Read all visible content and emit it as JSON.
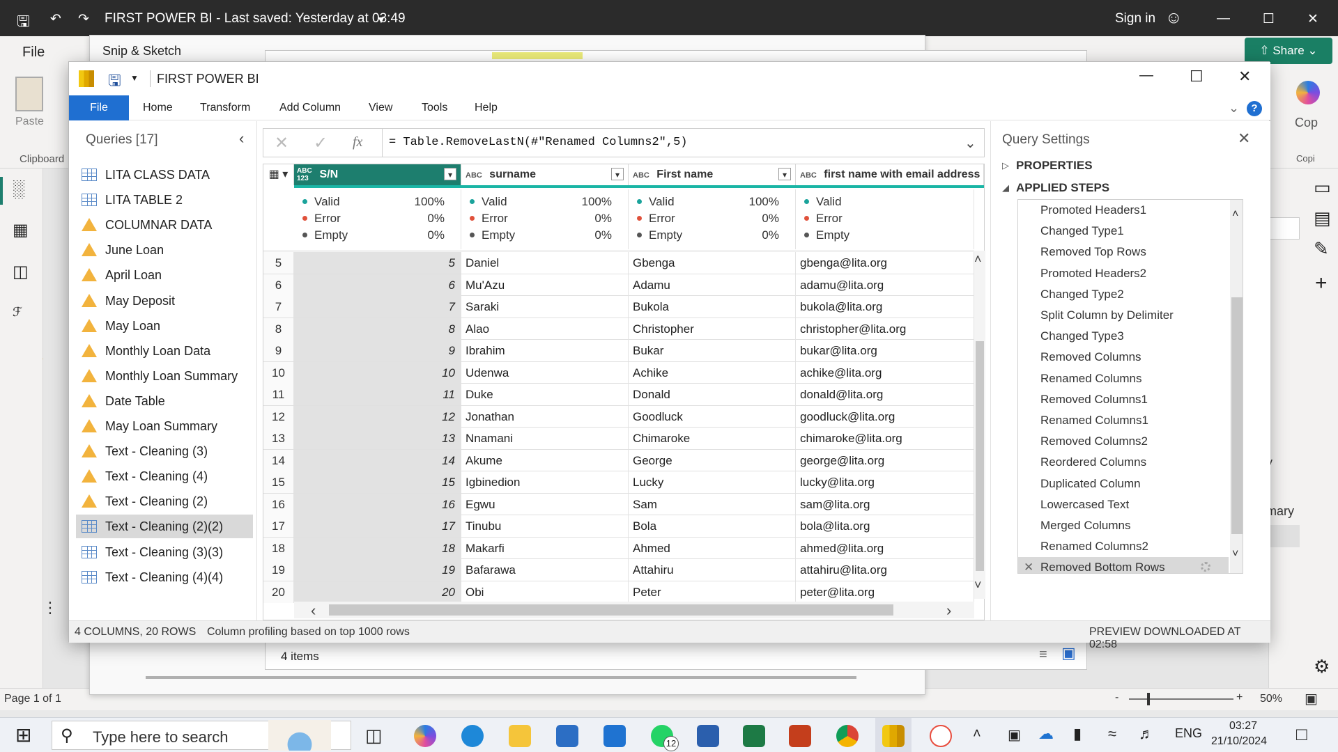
{
  "pbi": {
    "title": "FIRST POWER BI - Last saved: Yesterday at 03:49",
    "sign_in": "Sign in",
    "file_tab": "File",
    "share": "Share",
    "paste": "Paste",
    "clipboard": "Clipboard",
    "copilot": "Cop",
    "copilot2": "Copi",
    "page": "Page 1 of 1",
    "zoom": "50%",
    "side_text1": "y",
    "side_text2": "mary"
  },
  "snip": {
    "title": "Snip & Sketch"
  },
  "explorer": {
    "items": "4 items"
  },
  "pq": {
    "title": "FIRST POWER BI",
    "menu": [
      "File",
      "Home",
      "Transform",
      "Add Column",
      "View",
      "Tools",
      "Help"
    ],
    "queries_header": "Queries [17]",
    "queries": [
      {
        "name": "LITA CLASS DATA",
        "icon": "table-icon"
      },
      {
        "name": "LITA TABLE 2",
        "icon": "table-icon"
      },
      {
        "name": "COLUMNAR DATA",
        "icon": "warning-icon"
      },
      {
        "name": "June Loan",
        "icon": "warning-icon"
      },
      {
        "name": "April Loan",
        "icon": "warning-icon"
      },
      {
        "name": "May Deposit",
        "icon": "warning-icon"
      },
      {
        "name": "May Loan",
        "icon": "warning-icon"
      },
      {
        "name": "Monthly Loan Data",
        "icon": "warning-icon"
      },
      {
        "name": "Monthly Loan Summary",
        "icon": "warning-icon"
      },
      {
        "name": "Date Table",
        "icon": "warning-icon"
      },
      {
        "name": "May Loan Summary",
        "icon": "warning-icon"
      },
      {
        "name": "Text - Cleaning (3)",
        "icon": "warning-icon"
      },
      {
        "name": "Text - Cleaning (4)",
        "icon": "warning-icon"
      },
      {
        "name": "Text - Cleaning (2)",
        "icon": "warning-icon"
      },
      {
        "name": "Text - Cleaning (2)(2)",
        "icon": "table-icon"
      },
      {
        "name": "Text - Cleaning (3)(3)",
        "icon": "table-icon"
      },
      {
        "name": "Text - Cleaning (4)(4)",
        "icon": "table-icon"
      }
    ],
    "formula": "= Table.RemoveLastN(#\"Renamed Columns2\",5)",
    "fx": "fx",
    "columns": [
      {
        "type": "ABC 123",
        "name": "S/N"
      },
      {
        "type": "ABC",
        "name": "surname"
      },
      {
        "type": "ABC",
        "name": "First name"
      },
      {
        "type": "ABC",
        "name": "first name with email address"
      }
    ],
    "quality": {
      "valid_label": "Valid",
      "error_label": "Error",
      "empty_label": "Empty",
      "cols": [
        {
          "valid": "100%",
          "error": "0%",
          "empty": "0%"
        },
        {
          "valid": "100%",
          "error": "0%",
          "empty": "0%"
        },
        {
          "valid": "100%",
          "error": "0%",
          "empty": "0%"
        },
        {
          "valid": "",
          "error": "",
          "empty": ""
        }
      ]
    },
    "rows": [
      [
        "5",
        "5",
        "Daniel",
        "Gbenga",
        "gbenga@lita.org"
      ],
      [
        "6",
        "6",
        "Mu'Azu",
        "Adamu",
        "adamu@lita.org"
      ],
      [
        "7",
        "7",
        "Saraki",
        "Bukola",
        "bukola@lita.org"
      ],
      [
        "8",
        "8",
        "Alao",
        "Christopher",
        "christopher@lita.org"
      ],
      [
        "9",
        "9",
        "Ibrahim",
        "Bukar",
        "bukar@lita.org"
      ],
      [
        "10",
        "10",
        "Udenwa",
        "Achike",
        "achike@lita.org"
      ],
      [
        "11",
        "11",
        "Duke",
        "Donald",
        "donald@lita.org"
      ],
      [
        "12",
        "12",
        "Jonathan",
        "Goodluck",
        "goodluck@lita.org"
      ],
      [
        "13",
        "13",
        "Nnamani",
        "Chimaroke",
        "chimaroke@lita.org"
      ],
      [
        "14",
        "14",
        "Akume",
        "George",
        "george@lita.org"
      ],
      [
        "15",
        "15",
        "Igbinedion",
        "Lucky",
        "lucky@lita.org"
      ],
      [
        "16",
        "16",
        "Egwu",
        "Sam",
        "sam@lita.org"
      ],
      [
        "17",
        "17",
        "Tinubu",
        "Bola",
        "bola@lita.org"
      ],
      [
        "18",
        "18",
        "Makarfi",
        "Ahmed",
        "ahmed@lita.org"
      ],
      [
        "19",
        "19",
        "Bafarawa",
        "Attahiru",
        "attahiru@lita.org"
      ],
      [
        "20",
        "20",
        "Obi",
        "Peter",
        "peter@lita.org"
      ]
    ],
    "settings_title": "Query Settings",
    "properties": "PROPERTIES",
    "applied_steps": "APPLIED STEPS",
    "steps": [
      {
        "name": "Promoted Headers1",
        "gear": true
      },
      {
        "name": "Changed Type1",
        "gear": false
      },
      {
        "name": "Removed Top Rows",
        "gear": true
      },
      {
        "name": "Promoted Headers2",
        "gear": true
      },
      {
        "name": "Changed Type2",
        "gear": false
      },
      {
        "name": "Split Column by Delimiter",
        "gear": true
      },
      {
        "name": "Changed Type3",
        "gear": false
      },
      {
        "name": "Removed Columns",
        "gear": false
      },
      {
        "name": "Renamed Columns",
        "gear": false
      },
      {
        "name": "Removed Columns1",
        "gear": false
      },
      {
        "name": "Renamed Columns1",
        "gear": false
      },
      {
        "name": "Removed Columns2",
        "gear": false
      },
      {
        "name": "Reordered Columns",
        "gear": false
      },
      {
        "name": "Duplicated Column",
        "gear": false
      },
      {
        "name": "Lowercased Text",
        "gear": false
      },
      {
        "name": "Merged Columns",
        "gear": true
      },
      {
        "name": "Renamed Columns2",
        "gear": false
      },
      {
        "name": "Removed Bottom Rows",
        "gear": true
      }
    ],
    "status_left": "4 COLUMNS, 20 ROWS",
    "status_mid": "Column profiling based on top 1000 rows",
    "status_right": "PREVIEW DOWNLOADED AT 02:58"
  },
  "taskbar": {
    "search_placeholder": "Type here to search",
    "whatsapp_badge": "12",
    "lang": "ENG",
    "time": "03:27",
    "date": "21/10/2024"
  },
  "colors": {
    "selected_column": "#1d7e6e",
    "file_tab": "#1f6fd1",
    "warning": "#f2b33d",
    "valid_dot": "#1aa39b",
    "error_dot": "#e0513b",
    "share_button": "#1a7f64"
  }
}
